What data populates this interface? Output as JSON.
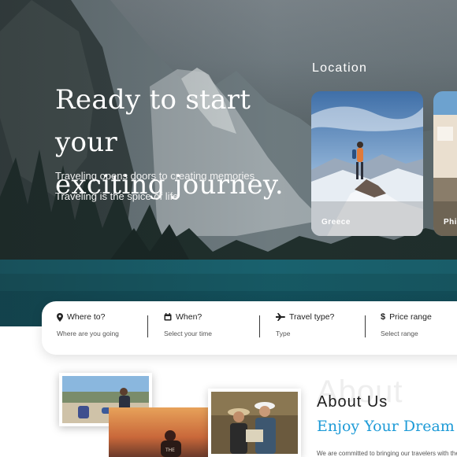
{
  "hero": {
    "title_line1": "Ready to start your",
    "title_line2": "exciting journey.",
    "subtitle1": "Traveling opens doors to creating memories",
    "subtitle2": "Traveling is the spice of life"
  },
  "location": {
    "heading": "Location",
    "cards": [
      {
        "label": "Greece"
      },
      {
        "label": "Phi"
      }
    ]
  },
  "search": {
    "fields": [
      {
        "label": "Where to?",
        "value": "Where are you going",
        "icon": "map-pin-icon"
      },
      {
        "label": "When?",
        "value": "Select your time",
        "icon": "calendar-icon"
      },
      {
        "label": "Travel type?",
        "value": "Type",
        "icon": "airplane-icon"
      },
      {
        "label": "Price range",
        "value": "Select range",
        "icon": "dollar-icon"
      }
    ]
  },
  "about": {
    "ghost": "About",
    "title": "About Us",
    "subtitle": "Enjoy Your Dream V",
    "text": "We are committed to bringing our travelers with the"
  },
  "colors": {
    "accent": "#1e9bd7",
    "lake": "#1a6b78"
  }
}
